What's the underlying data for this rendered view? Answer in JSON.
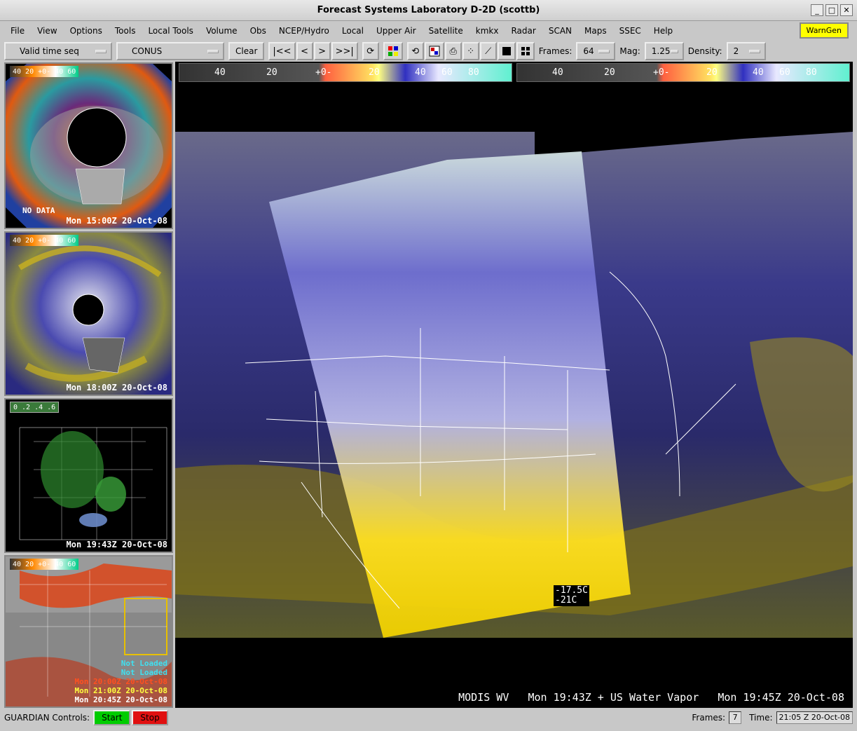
{
  "window": {
    "title": "Forecast Systems Laboratory D-2D (scottb)"
  },
  "menu": {
    "items": [
      "File",
      "View",
      "Options",
      "Tools",
      "Local Tools",
      "Volume",
      "Obs",
      "NCEP/Hydro",
      "Local",
      "Upper Air",
      "Satellite",
      "kmkx",
      "Radar",
      "SCAN",
      "Maps",
      "SSEC",
      "Help"
    ],
    "warngen": "WarnGen"
  },
  "toolbar": {
    "time_mode": "Valid time seq",
    "scale": "CONUS",
    "clear": "Clear",
    "frames_label": "Frames:",
    "frames_value": "64",
    "mag_label": "Mag:",
    "mag_value": "1.25",
    "density_label": "Density:",
    "density_value": "2"
  },
  "side_panels": [
    {
      "legend": "40 20 +0- 40 60",
      "caption_top": "NO DATA",
      "caption": "Mon 15:00Z 20-Oct-08"
    },
    {
      "legend": "40 20 +0- 40 60",
      "caption": "Mon 18:00Z 20-Oct-08"
    },
    {
      "legend": "0 .2 .4 .6",
      "caption": "Mon 19:43Z 20-Oct-08"
    },
    {
      "legend": "40 20 +0- 40 60",
      "lines": [
        "Not Loaded",
        "Not Loaded",
        "Mon 20:00Z 20-Oct-08",
        "Mon 21:00Z 20-Oct-08",
        "Mon 20:45Z 20-Oct-08"
      ]
    }
  ],
  "main": {
    "colorbar_labels": [
      "40",
      "20",
      "+0-",
      "20",
      "40",
      "60",
      "80"
    ],
    "readout": [
      "-17.5C",
      "-21C"
    ],
    "bottom_label": "MODIS WV   Mon 19:43Z + US Water Vapor   Mon 19:45Z 20-Oct-08"
  },
  "status": {
    "guardian_label": "GUARDIAN Controls:",
    "start": "Start",
    "stop": "Stop",
    "frames_label": "Frames:",
    "frames_value": "7",
    "time_label": "Time:",
    "time_value": "21:05 Z 20-Oct-08"
  },
  "colors": {
    "warngen": "#ffff00",
    "start": "#00cc00",
    "stop": "#e01010"
  }
}
